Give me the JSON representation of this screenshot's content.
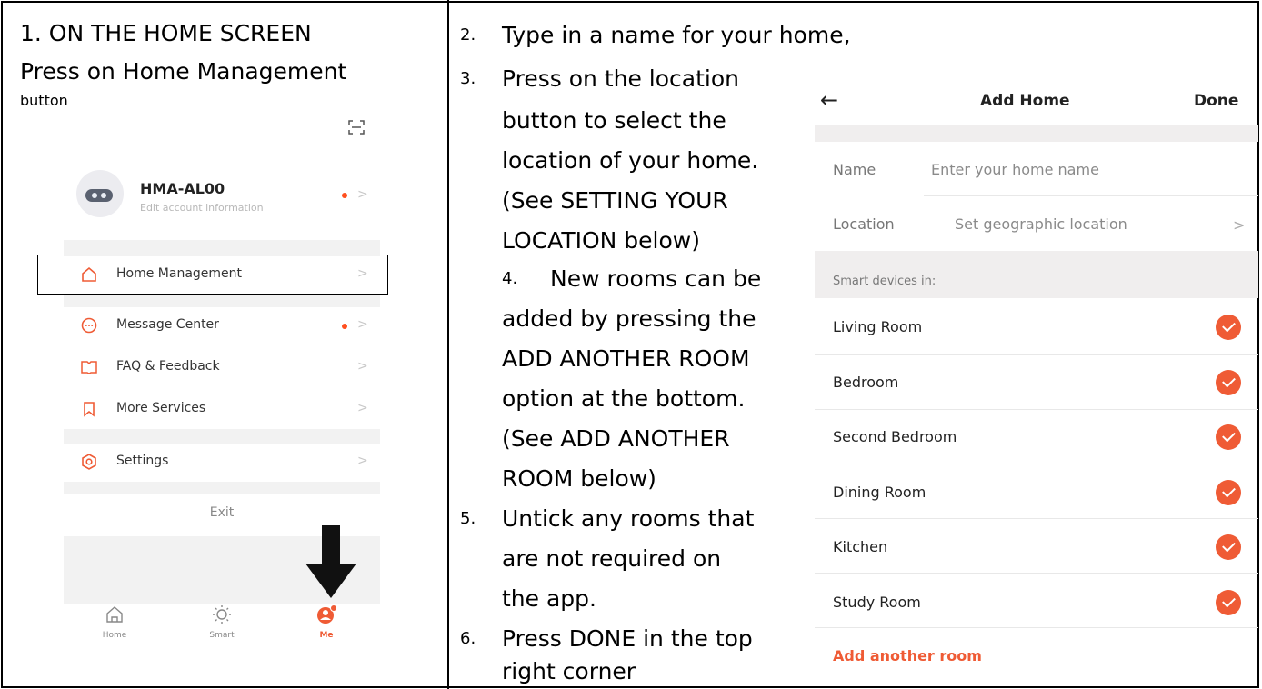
{
  "left": {
    "heading_line1": "1. ON THE HOME SCREEN",
    "heading_line2": "Press on Home Management",
    "heading_line3": "button",
    "scan_icon": "scan-icon",
    "profile": {
      "name": "HMA-AL00",
      "subtitle": "Edit account information"
    },
    "menu": [
      {
        "label": "Home Management",
        "icon": "home-icon"
      },
      {
        "label": "Message Center",
        "icon": "message-icon"
      },
      {
        "label": "FAQ & Feedback",
        "icon": "book-icon"
      },
      {
        "label": "More Services",
        "icon": "bookmark-icon"
      },
      {
        "label": "Settings",
        "icon": "settings-icon"
      }
    ],
    "exit": "Exit",
    "tabs": [
      {
        "label": "Home",
        "icon": "home-tab-icon"
      },
      {
        "label": "Smart",
        "icon": "sun-icon"
      },
      {
        "label": "Me",
        "icon": "me-icon"
      }
    ],
    "accent": "#ff4f1f"
  },
  "middle": {
    "s2_num": "2.",
    "s2_l1": "Type in a name for your home,",
    "s3_num": "3.",
    "s3_l1": "Press on the location",
    "s3_l2": "button to select the",
    "s3_l3": "location of your home.",
    "s3_l4": "(See SETTING YOUR",
    "s3_l5": "LOCATION below)",
    "s4_num": "4.",
    "s4_l1": "New rooms can be",
    "s4_l2": "added by pressing the",
    "s4_l3": "ADD ANOTHER ROOM",
    "s4_l4": "option at the bottom.",
    "s4_l5": "(See ADD ANOTHER",
    "s4_l6": "ROOM below)",
    "s5_num": "5.",
    "s5_l1": "Untick any rooms that",
    "s5_l2": "are not required on",
    "s5_l3": "the app.",
    "s6_num": "6.",
    "s6_l1": "Press DONE in the top",
    "s6_l2": "right corner"
  },
  "right": {
    "back_icon": "back-arrow-icon",
    "title": "Add Home",
    "done": "Done",
    "name_label": "Name",
    "name_placeholder": "Enter your home name",
    "location_label": "Location",
    "location_value": "Set geographic location",
    "section": "Smart devices in:",
    "rooms": [
      "Living Room",
      "Bedroom",
      "Second Bedroom",
      "Dining Room",
      "Kitchen",
      "Study Room"
    ],
    "add_room": "Add another room",
    "accent": "#ef5b35"
  }
}
